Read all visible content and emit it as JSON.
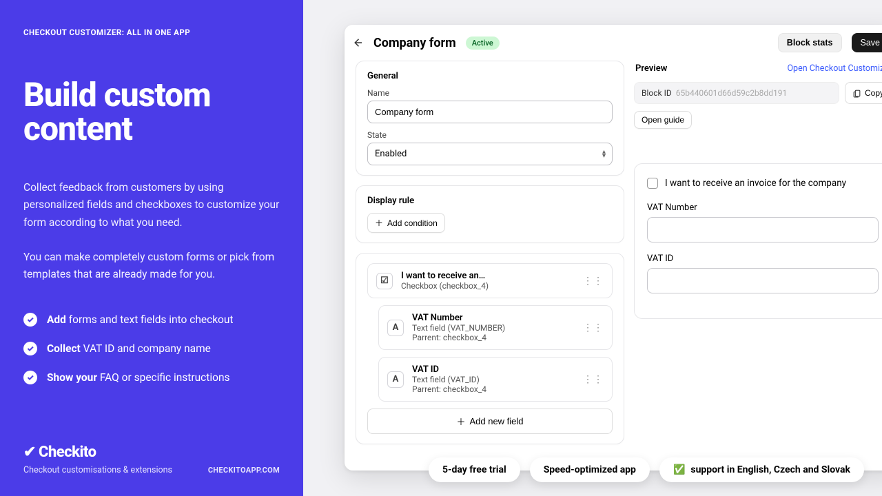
{
  "left": {
    "kicker": "CHECKOUT CUSTOMIZER: ALL IN ONE APP",
    "title": "Build custom content",
    "para1": "Collect feedback from customers by using personalized fields and checkboxes to customize your form according to what you need.",
    "para2": "You can make completely custom forms or pick from templates that are already made for you.",
    "bullets": {
      "b1_bold": "Add",
      "b1_rest": " forms and text fields into checkout",
      "b2_bold": "Collect",
      "b2_rest": " VAT ID and company name",
      "b3_bold": "Show your",
      "b3_rest": " FAQ or specific instructions"
    },
    "logo": "Checkito",
    "tagline": "Checkout customisations & extensions",
    "website": "CHECKITOAPP.COM"
  },
  "header": {
    "title": "Company form",
    "status": "Active",
    "block_stats": "Block stats",
    "save": "Save"
  },
  "general": {
    "heading": "General",
    "name_label": "Name",
    "name_value": "Company form",
    "state_label": "State",
    "state_value": "Enabled"
  },
  "display_rule": {
    "heading": "Display rule",
    "add_condition": "Add condition"
  },
  "fields": {
    "f1_title": "I want to receive an…",
    "f1_sub": "Checkbox (checkbox_4)",
    "f2_title": "VAT Number",
    "f2_sub": "Text field (VAT_NUMBER)",
    "f2_parent": "Parrent: checkbox_4",
    "f3_title": "VAT ID",
    "f3_sub": "Text field (VAT_ID)",
    "f3_parent": "Parrent: checkbox_4",
    "add_new": "Add new field"
  },
  "preview": {
    "heading": "Preview",
    "open_customizer": "Open Checkout Customizer",
    "block_id_label": "Block ID",
    "block_id_value": "65b440601d66d59c2b8dd191",
    "copy": "Copy",
    "open_guide": "Open guide",
    "chk_label": "I want to receive an invoice for the company",
    "vat_number_label": "VAT Number",
    "vat_id_label": "VAT ID"
  },
  "pills": {
    "p1": "5-day free trial",
    "p2": "Speed-optimized app",
    "p3": "support in English, Czech and Slovak"
  }
}
